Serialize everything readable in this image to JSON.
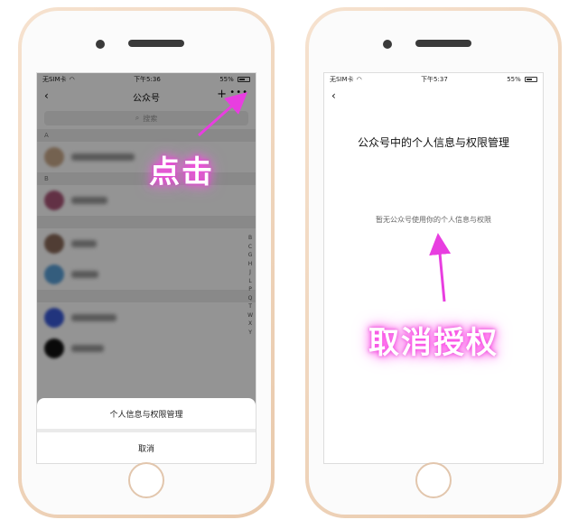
{
  "left": {
    "status": {
      "carrier": "无SIM卡",
      "time": "下午5:36",
      "battery": "55%"
    },
    "nav": {
      "back_icon": "‹",
      "title": "公众号",
      "add_icon": "+",
      "more_icon": "•••"
    },
    "search": {
      "placeholder": "搜索"
    },
    "sections": [
      "A",
      "B"
    ],
    "index_letters": [
      "B",
      "C",
      "G",
      "H",
      "J",
      "L",
      "P",
      "Q",
      "T",
      "W",
      "X",
      "Y"
    ],
    "sheet": {
      "option": "个人信息与权限管理",
      "cancel": "取消"
    },
    "annotation": "点击"
  },
  "right": {
    "status": {
      "time": "下午5:37",
      "battery": "55%"
    },
    "nav": {
      "back_icon": "‹"
    },
    "title": "公众号中的个人信息与权限管理",
    "empty": "暂无公众号使用你的个人信息与权限",
    "annotation": "取消授权"
  },
  "colors": {
    "arrow": "#e83ee0",
    "glow": "#ff40e8"
  }
}
